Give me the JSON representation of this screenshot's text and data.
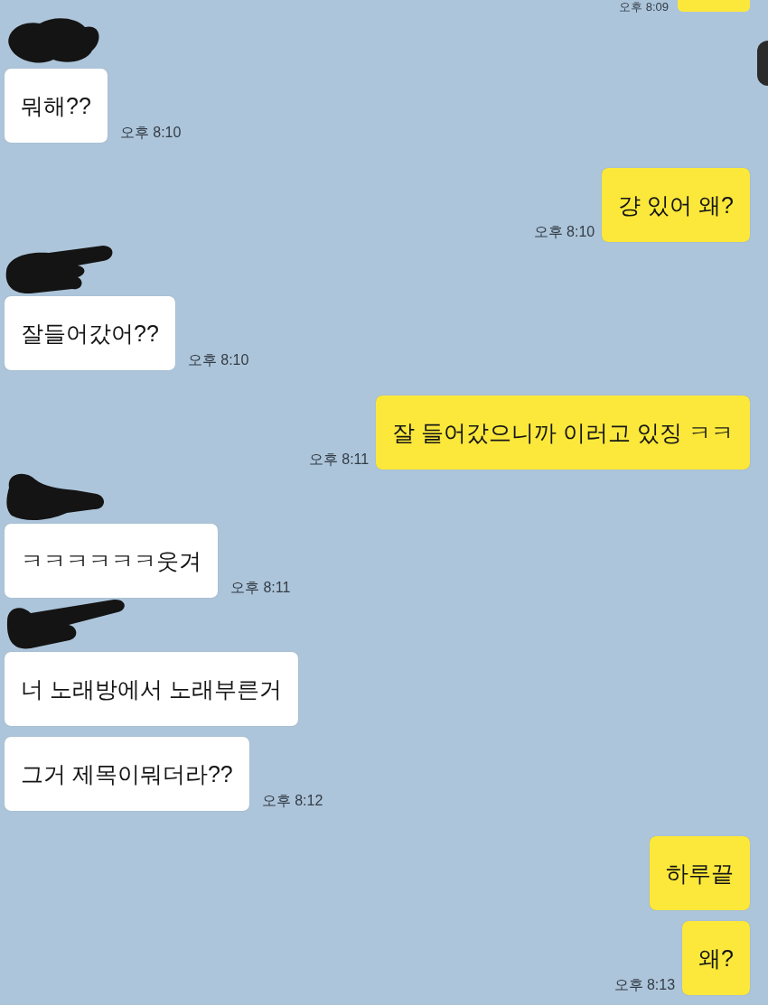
{
  "previous_message": {
    "kind": "outgoing",
    "time": "오후 8:09"
  },
  "groups": [
    {
      "kind": "incoming",
      "sender_redacted": true,
      "messages": [
        {
          "text": "뭐해??",
          "time": "오후 8:10"
        }
      ]
    },
    {
      "kind": "outgoing",
      "sender_redacted": false,
      "messages": [
        {
          "text": "걍 있어 왜?",
          "time": "오후 8:10"
        }
      ]
    },
    {
      "kind": "incoming",
      "sender_redacted": true,
      "messages": [
        {
          "text": "잘들어갔어??",
          "time": "오후 8:10"
        }
      ]
    },
    {
      "kind": "outgoing",
      "sender_redacted": false,
      "messages": [
        {
          "text": "잘 들어갔으니까 이러고 있징 ㅋㅋ",
          "time": "오후 8:11"
        }
      ]
    },
    {
      "kind": "incoming",
      "sender_redacted": true,
      "messages": [
        {
          "text": "ㅋㅋㅋㅋㅋㅋ웃겨",
          "time": "오후 8:11"
        }
      ]
    },
    {
      "kind": "incoming",
      "sender_redacted": true,
      "messages": [
        {
          "text": "너 노래방에서 노래부른거"
        },
        {
          "text": "그거 제목이뭐더라??",
          "time": "오후 8:12"
        }
      ]
    },
    {
      "kind": "outgoing",
      "sender_redacted": false,
      "messages": [
        {
          "text": "하루끝"
        },
        {
          "text": "왜?",
          "time": "오후 8:13"
        }
      ]
    }
  ]
}
